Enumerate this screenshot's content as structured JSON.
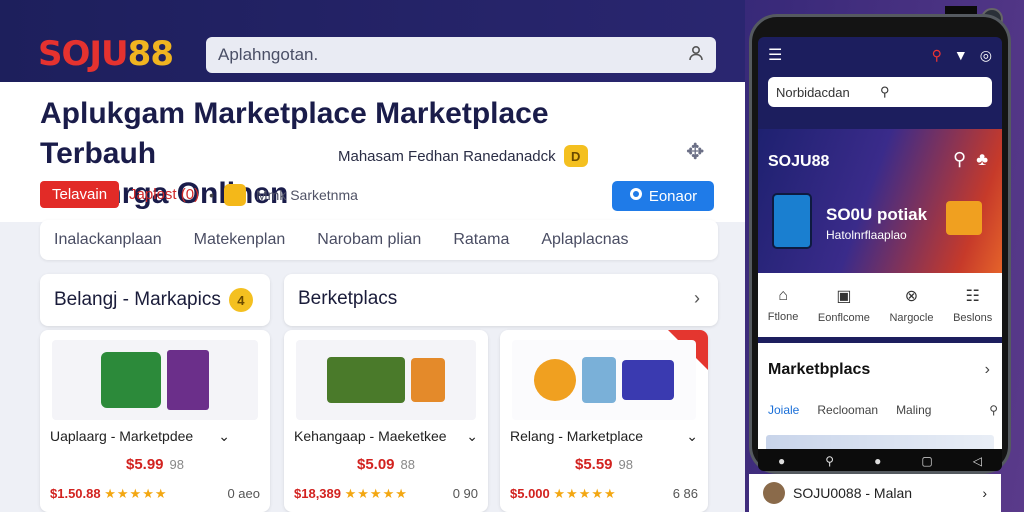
{
  "header": {
    "logo_part1": "SOJU",
    "logo_part2": "88",
    "search_placeholder": "Aplahngotan."
  },
  "hero": {
    "title_line1": "Aplukgam Marketplace Marketplace Terbauh",
    "title_line2": "Belanrga Onlinen",
    "subtitle": "Mahasam Fedhan Ranedanadck",
    "subtitle_badge": "D",
    "button_red": "Telavain",
    "red_link": "Japlost",
    "red_link_badge": "0",
    "grey_link": "Mmk Sarketnma",
    "button_blue": "Eonaor"
  },
  "tabs": [
    "Inalackanplaan",
    "Matekenplan",
    "Narobam plian",
    "Ratama",
    "Aplaplacnas"
  ],
  "section_left": {
    "title": "Belangj - Markapics",
    "badge": "4"
  },
  "section_right": {
    "title": "Berketplacs"
  },
  "products": [
    {
      "name": "Uaplaarg - Marketpdee",
      "price": "$5.99",
      "price_old": "98",
      "foot_price": "$1.50.88",
      "rating": "★★★★★",
      "count": "0 aeo"
    },
    {
      "name": "Kehangaap - Maeketkee",
      "price": "$5.09",
      "price_old": "88",
      "foot_price": "$18,389",
      "rating": "★★★★★",
      "count": "0 90"
    },
    {
      "name": "Relang - Marketplace",
      "price": "$5.59",
      "price_old": "98",
      "foot_price": "$5.000",
      "rating": "★★★★★",
      "count": "6 86"
    }
  ],
  "phone": {
    "search": "Norbidacdan",
    "brand": "SOJU88",
    "promo_big": "SO0U potiak",
    "promo_small": "Hatolnrflaaplao",
    "nav": [
      "Ftlone",
      "Eonflcome",
      "Nargocle",
      "Beslons"
    ],
    "section_title": "Marketbplacs",
    "tabs2": [
      "Joiale",
      "Reclooman",
      "Maling"
    ]
  },
  "bottom_card": {
    "text": "SOJU0088 - Malan"
  },
  "colors": {
    "accent_red": "#e22b27",
    "accent_blue": "#1f7be8",
    "brand_gold": "#f0b420",
    "navy": "#1d1f5c"
  }
}
